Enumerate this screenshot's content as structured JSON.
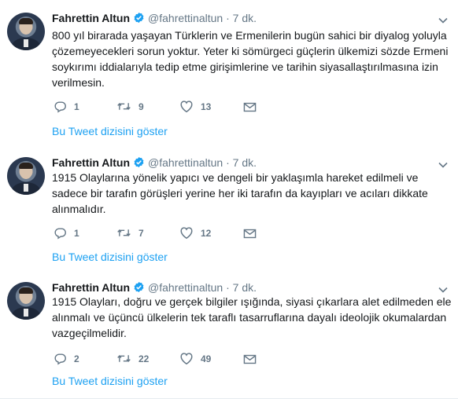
{
  "tweets": [
    {
      "name": "Fahrettin Altun",
      "handle": "@fahrettinaltun",
      "separator": "·",
      "time": "7 dk.",
      "lines": [
        "800 yıl birarada yaşayan Türklerin ve Ermenilerin bugün sahici bir diyalog yoluyla",
        "çözemeyecekleri sorun yoktur. Yeter ki sömürgeci güçlerin ülkemizi sözde Ermeni",
        "soykırımı iddialarıyla tedip etme girişimlerine ve tarihin siyasallaştırılmasına izin",
        "verilmesin."
      ],
      "replies": "1",
      "retweets": "9",
      "likes": "13",
      "thread_link": "Bu Tweet dizisini göster"
    },
    {
      "name": "Fahrettin Altun",
      "handle": "@fahrettinaltun",
      "separator": "·",
      "time": "7 dk.",
      "lines": [
        "1915 Olaylarına yönelik yapıcı ve dengeli bir yaklaşımla hareket edilmeli ve",
        "sadece bir tarafın görüşleri yerine her iki tarafın da kayıpları ve acıları dikkate",
        "alınmalıdır."
      ],
      "replies": "1",
      "retweets": "7",
      "likes": "12",
      "thread_link": "Bu Tweet dizisini göster"
    },
    {
      "name": "Fahrettin Altun",
      "handle": "@fahrettinaltun",
      "separator": "·",
      "time": "7 dk.",
      "lines": [
        "1915 Olayları, doğru ve gerçek bilgiler ışığında, siyasi çıkarlara alet edilmeden ele",
        "alınmalı ve üçüncü ülkelerin tek taraflı tasarruflarına dayalı ideolojik okumalardan",
        "vazgeçilmelidir."
      ],
      "replies": "2",
      "retweets": "22",
      "likes": "49",
      "thread_link": "Bu Tweet dizisini göster"
    }
  ],
  "icons": {
    "verified": "verified-badge-icon",
    "caret": "chevron-down-icon",
    "reply": "reply-icon",
    "retweet": "retweet-icon",
    "like": "heart-icon",
    "message": "envelope-icon"
  },
  "colors": {
    "accent": "#1da1f2",
    "muted": "#657786",
    "text": "#14171a",
    "divider": "#e6ecf0"
  }
}
